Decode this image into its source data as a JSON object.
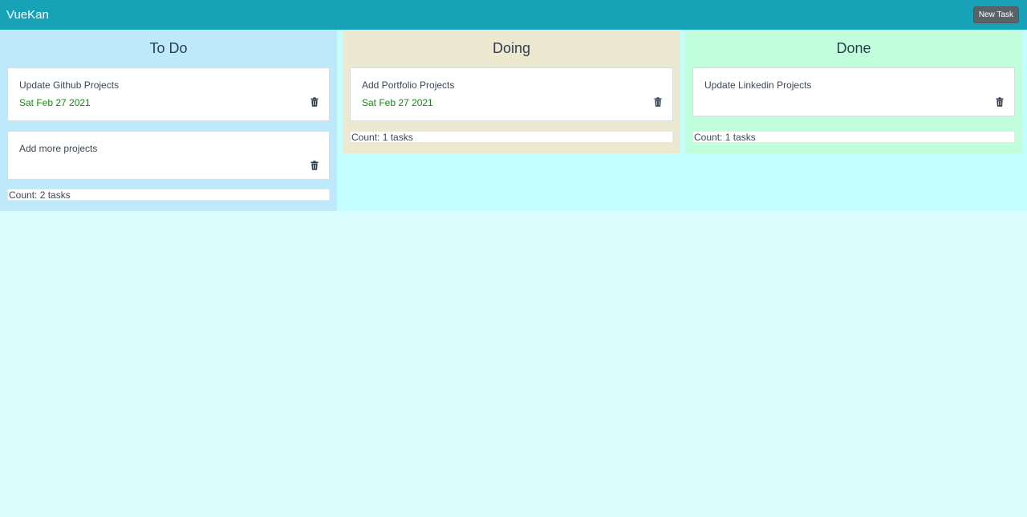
{
  "header": {
    "brand": "VueKan",
    "new_task_label": "New Task"
  },
  "columns": [
    {
      "title": "To Do",
      "cards": [
        {
          "title": "Update Github Projects",
          "date": "Sat Feb 27 2021"
        },
        {
          "title": "Add more projects",
          "date": ""
        }
      ],
      "count": "Count: 2 tasks"
    },
    {
      "title": "Doing",
      "cards": [
        {
          "title": "Add Portfolio Projects",
          "date": "Sat Feb 27 2021"
        }
      ],
      "count": "Count: 1 tasks"
    },
    {
      "title": "Done",
      "cards": [
        {
          "title": "Update Linkedin Projects",
          "date": ""
        }
      ],
      "count": "Count: 1 tasks"
    }
  ],
  "colors": {
    "navbar": "#17a2b8",
    "todo_bg": "#bee9fb",
    "doing_bg": "#ede8d0",
    "done_bg": "#c1fedb",
    "date_text": "#178a17"
  },
  "icons": {
    "delete": "trash-icon"
  }
}
